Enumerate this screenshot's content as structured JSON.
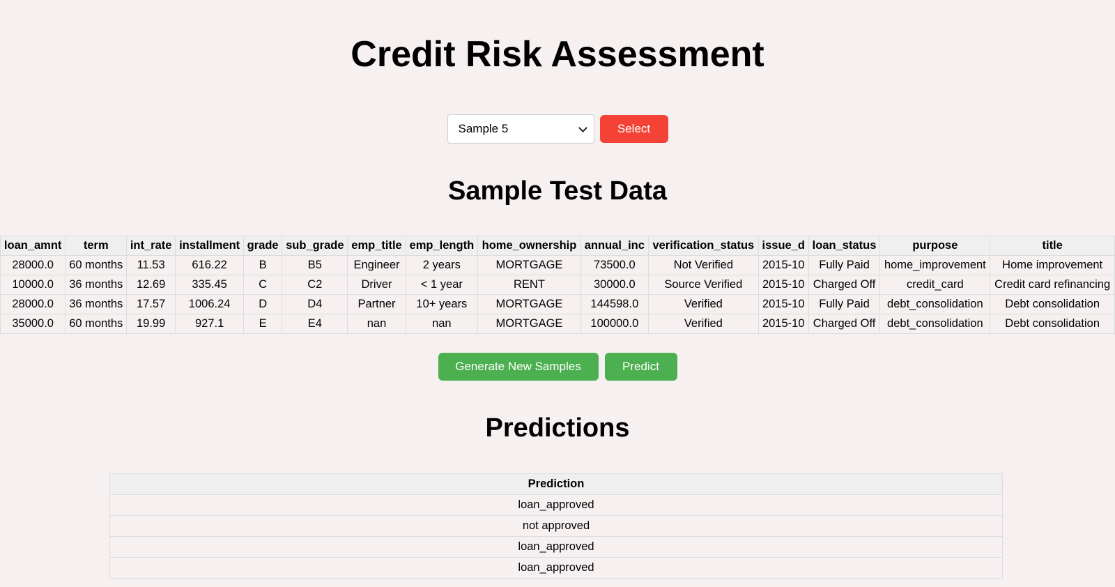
{
  "page": {
    "title": "Credit Risk Assessment"
  },
  "selector": {
    "selected": "Sample 5",
    "select_label": "Select"
  },
  "sample_section": {
    "heading": "Sample Test Data",
    "columns": [
      "loan_amnt",
      "term",
      "int_rate",
      "installment",
      "grade",
      "sub_grade",
      "emp_title",
      "emp_length",
      "home_ownership",
      "annual_inc",
      "verification_status",
      "issue_d",
      "loan_status",
      "purpose",
      "title"
    ],
    "rows": [
      [
        "28000.0",
        "60 months",
        "11.53",
        "616.22",
        "B",
        "B5",
        "Engineer",
        "2 years",
        "MORTGAGE",
        "73500.0",
        "Not Verified",
        "2015-10",
        "Fully Paid",
        "home_improvement",
        "Home improvement"
      ],
      [
        "10000.0",
        "36 months",
        "12.69",
        "335.45",
        "C",
        "C2",
        "Driver",
        "< 1 year",
        "RENT",
        "30000.0",
        "Source Verified",
        "2015-10",
        "Charged Off",
        "credit_card",
        "Credit card refinancing"
      ],
      [
        "28000.0",
        "36 months",
        "17.57",
        "1006.24",
        "D",
        "D4",
        "Partner",
        "10+ years",
        "MORTGAGE",
        "144598.0",
        "Verified",
        "2015-10",
        "Fully Paid",
        "debt_consolidation",
        "Debt consolidation"
      ],
      [
        "35000.0",
        "60 months",
        "19.99",
        "927.1",
        "E",
        "E4",
        "nan",
        "nan",
        "MORTGAGE",
        "100000.0",
        "Verified",
        "2015-10",
        "Charged Off",
        "debt_consolidation",
        "Debt consolidation"
      ]
    ]
  },
  "actions": {
    "generate_label": "Generate New Samples",
    "predict_label": "Predict"
  },
  "predictions_section": {
    "heading": "Predictions",
    "column": "Prediction",
    "values": [
      "loan_approved",
      "not approved",
      "loan_approved",
      "loan_approved"
    ]
  },
  "colors": {
    "background": "#f6f0f0",
    "select_button": "#f44336",
    "action_buttons": "#4caf50",
    "table_header": "#efefef"
  },
  "icons": {
    "dropdown": "chevron-down-icon"
  }
}
